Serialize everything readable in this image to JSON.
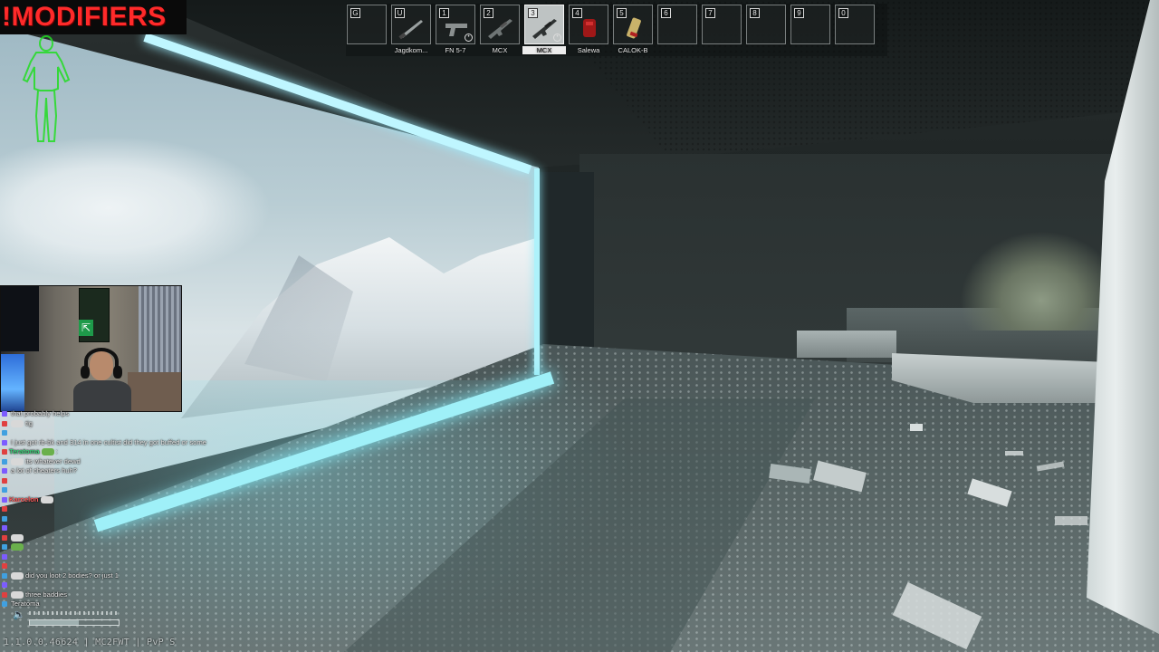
{
  "banner": {
    "text": "!MODIFIERS",
    "color": "#ff2a2a"
  },
  "body_status": {
    "icon": "body-silhouette-icon",
    "color": "#22dd22"
  },
  "hotbar": {
    "slots": [
      {
        "key": "G",
        "label": "",
        "icon": "empty",
        "selected": false,
        "badge": false
      },
      {
        "key": "U",
        "label": "Jagdkom...",
        "icon": "knife-icon",
        "selected": false,
        "badge": false
      },
      {
        "key": "1",
        "label": "FN 5-7",
        "icon": "pistol-icon",
        "selected": false,
        "badge": true
      },
      {
        "key": "2",
        "label": "MCX",
        "icon": "rifle-icon",
        "selected": false,
        "badge": false
      },
      {
        "key": "3",
        "label": "MCX",
        "icon": "rifle-icon",
        "selected": true,
        "badge": true
      },
      {
        "key": "4",
        "label": "Salewa",
        "icon": "medkit-icon",
        "selected": false,
        "badge": false
      },
      {
        "key": "5",
        "label": "CALOK-B",
        "icon": "injector-icon",
        "selected": false,
        "badge": false
      },
      {
        "key": "6",
        "label": "",
        "icon": "empty",
        "selected": false,
        "badge": false
      },
      {
        "key": "7",
        "label": "",
        "icon": "empty",
        "selected": false,
        "badge": false
      },
      {
        "key": "8",
        "label": "",
        "icon": "empty",
        "selected": false,
        "badge": false
      },
      {
        "key": "9",
        "label": "",
        "icon": "empty",
        "selected": false,
        "badge": false
      },
      {
        "key": "0",
        "label": "",
        "icon": "empty",
        "selected": false,
        "badge": false
      }
    ]
  },
  "chat": {
    "lines": [
      {
        "user": "",
        "color": "#6ea8ff",
        "text": "that probably helps"
      },
      {
        "user": "",
        "color": "#c8a030",
        "text": "tig"
      },
      {
        "user": "",
        "color": "#e8e8e8",
        "text": ""
      },
      {
        "user": "",
        "color": "#6ea8ff",
        "text": "I just got rb-bk and 314 in one cultist did they got buffed or some"
      },
      {
        "user": "Teratoma",
        "color": "#3cd27a",
        "text": ":"
      },
      {
        "user": "",
        "color": "#6ea8ff",
        "text": "its whatever dewd"
      },
      {
        "user": "",
        "color": "#c8a030",
        "text": "a lot of cheaters huh?"
      },
      {
        "user": "",
        "color": "#6ea8ff",
        "text": ""
      },
      {
        "user": "",
        "color": "#6ea8ff",
        "text": ""
      },
      {
        "user": "Karcelon",
        "color": "#ff6060",
        "text": ""
      },
      {
        "user": "",
        "color": "#6ea8ff",
        "text": ""
      },
      {
        "user": "",
        "color": "#6ea8ff",
        "text": ""
      },
      {
        "user": "",
        "color": "#6ea8ff",
        "text": ""
      },
      {
        "user": "",
        "color": "#6ea8ff",
        "text": ""
      },
      {
        "user": "",
        "color": "#c8a030",
        "text": ""
      },
      {
        "user": "",
        "color": "#6ea8ff",
        "text": ""
      },
      {
        "user": "",
        "color": "#6ea8ff",
        "text": ""
      },
      {
        "user": "",
        "color": "#6ea8ff",
        "text": "did you loot 2 bodies? or just 1"
      },
      {
        "user": "",
        "color": "#c8a030",
        "text": ""
      },
      {
        "user": "",
        "color": "#3cd27a",
        "text": "three baddies"
      },
      {
        "user": "",
        "color": "#c8a030",
        "text": "Teratoma"
      }
    ]
  },
  "volume": {
    "icon": "speaker-icon",
    "level": 0.55
  },
  "version": {
    "text": "1.1.0.0.46624 | MC2FWT | PvP S"
  },
  "webcam": {
    "sign_icon": "exit-sign-icon"
  }
}
